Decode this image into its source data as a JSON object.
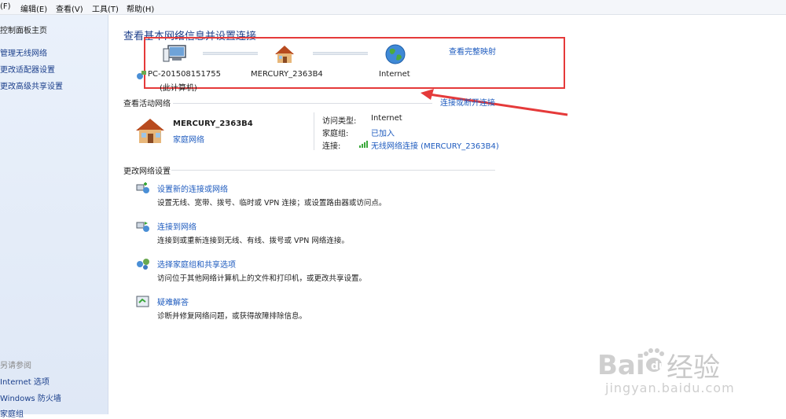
{
  "menu": [
    "(F)",
    "编辑(E)",
    "查看(V)",
    "工具(T)",
    "帮助(H)"
  ],
  "sidebar": {
    "items": [
      "控制面板主页",
      "管理无线网络",
      "更改适配器设置",
      "更改高级共享设置"
    ],
    "see_also": "另请参阅",
    "bottom_items": [
      "Internet 选项",
      "Windows 防火墙",
      "家庭组"
    ]
  },
  "title": "查看基本网络信息并设置连接",
  "network_map": {
    "computer_name": "PC-201508151755",
    "computer_sub": "(此计算机)",
    "router_name": "MERCURY_2363B4",
    "internet_label": "Internet",
    "full_map_link": "查看完整映射",
    "connect_disconnect": "连接或断开连接"
  },
  "active_networks": {
    "header": "查看活动网络",
    "name": "MERCURY_2363B4",
    "type": "家庭网络",
    "access_type_label": "访问类型:",
    "access_type_value": "Internet",
    "homegroup_label": "家庭组:",
    "homegroup_value": "已加入",
    "connections_label": "连接:",
    "connections_value": "无线网络连接 (MERCURY_2363B4)"
  },
  "change_settings": {
    "header": "更改网络设置",
    "tasks": [
      {
        "title": "设置新的连接或网络",
        "desc": "设置无线、宽带、拨号、临时或 VPN 连接；或设置路由器或访问点。"
      },
      {
        "title": "连接到网络",
        "desc": "连接到或重新连接到无线、有线、拨号或 VPN 网络连接。"
      },
      {
        "title": "选择家庭组和共享选项",
        "desc": "访问位于其他网络计算机上的文件和打印机，或更改共享设置。"
      },
      {
        "title": "疑难解答",
        "desc": "诊断并修复网络问题，或获得故障排除信息。"
      }
    ]
  },
  "watermark": {
    "text": "经验",
    "url": "jingyan.baidu.com"
  },
  "colors": {
    "link": "#1e5bbf",
    "title": "#1e3f8a",
    "highlight_box": "#e53a3a"
  }
}
